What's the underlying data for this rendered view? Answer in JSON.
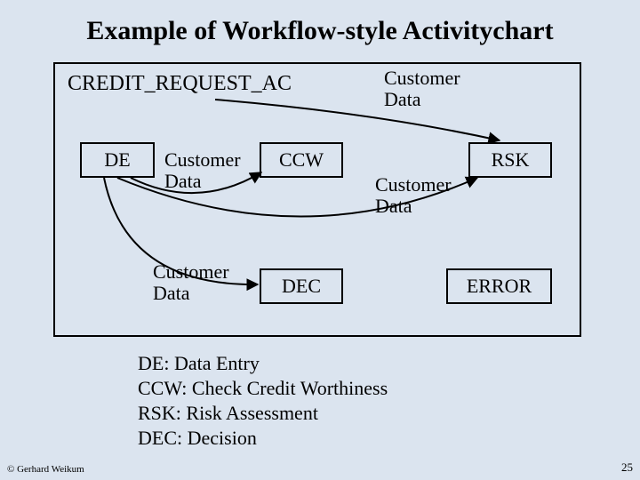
{
  "title": "Example of Workflow-style Activitychart",
  "chart_name": "CREDIT_REQUEST_AC",
  "data_item": "Customer\nData",
  "nodes": {
    "de": {
      "label": "DE",
      "desc": "Data Entry"
    },
    "ccw": {
      "label": "CCW",
      "desc": "Check Credit Worthiness"
    },
    "rsk": {
      "label": "RSK",
      "desc": "Risk Assessment"
    },
    "dec": {
      "label": "DEC",
      "desc": "Decision"
    },
    "error": {
      "label": "ERROR",
      "desc": ""
    }
  },
  "legend": [
    "DE: Data Entry",
    "CCW: Check Credit Worthiness",
    "RSK: Risk Assessment",
    "DEC: Decision"
  ],
  "copyright": "© Gerhard Weikum",
  "page_number": "25"
}
